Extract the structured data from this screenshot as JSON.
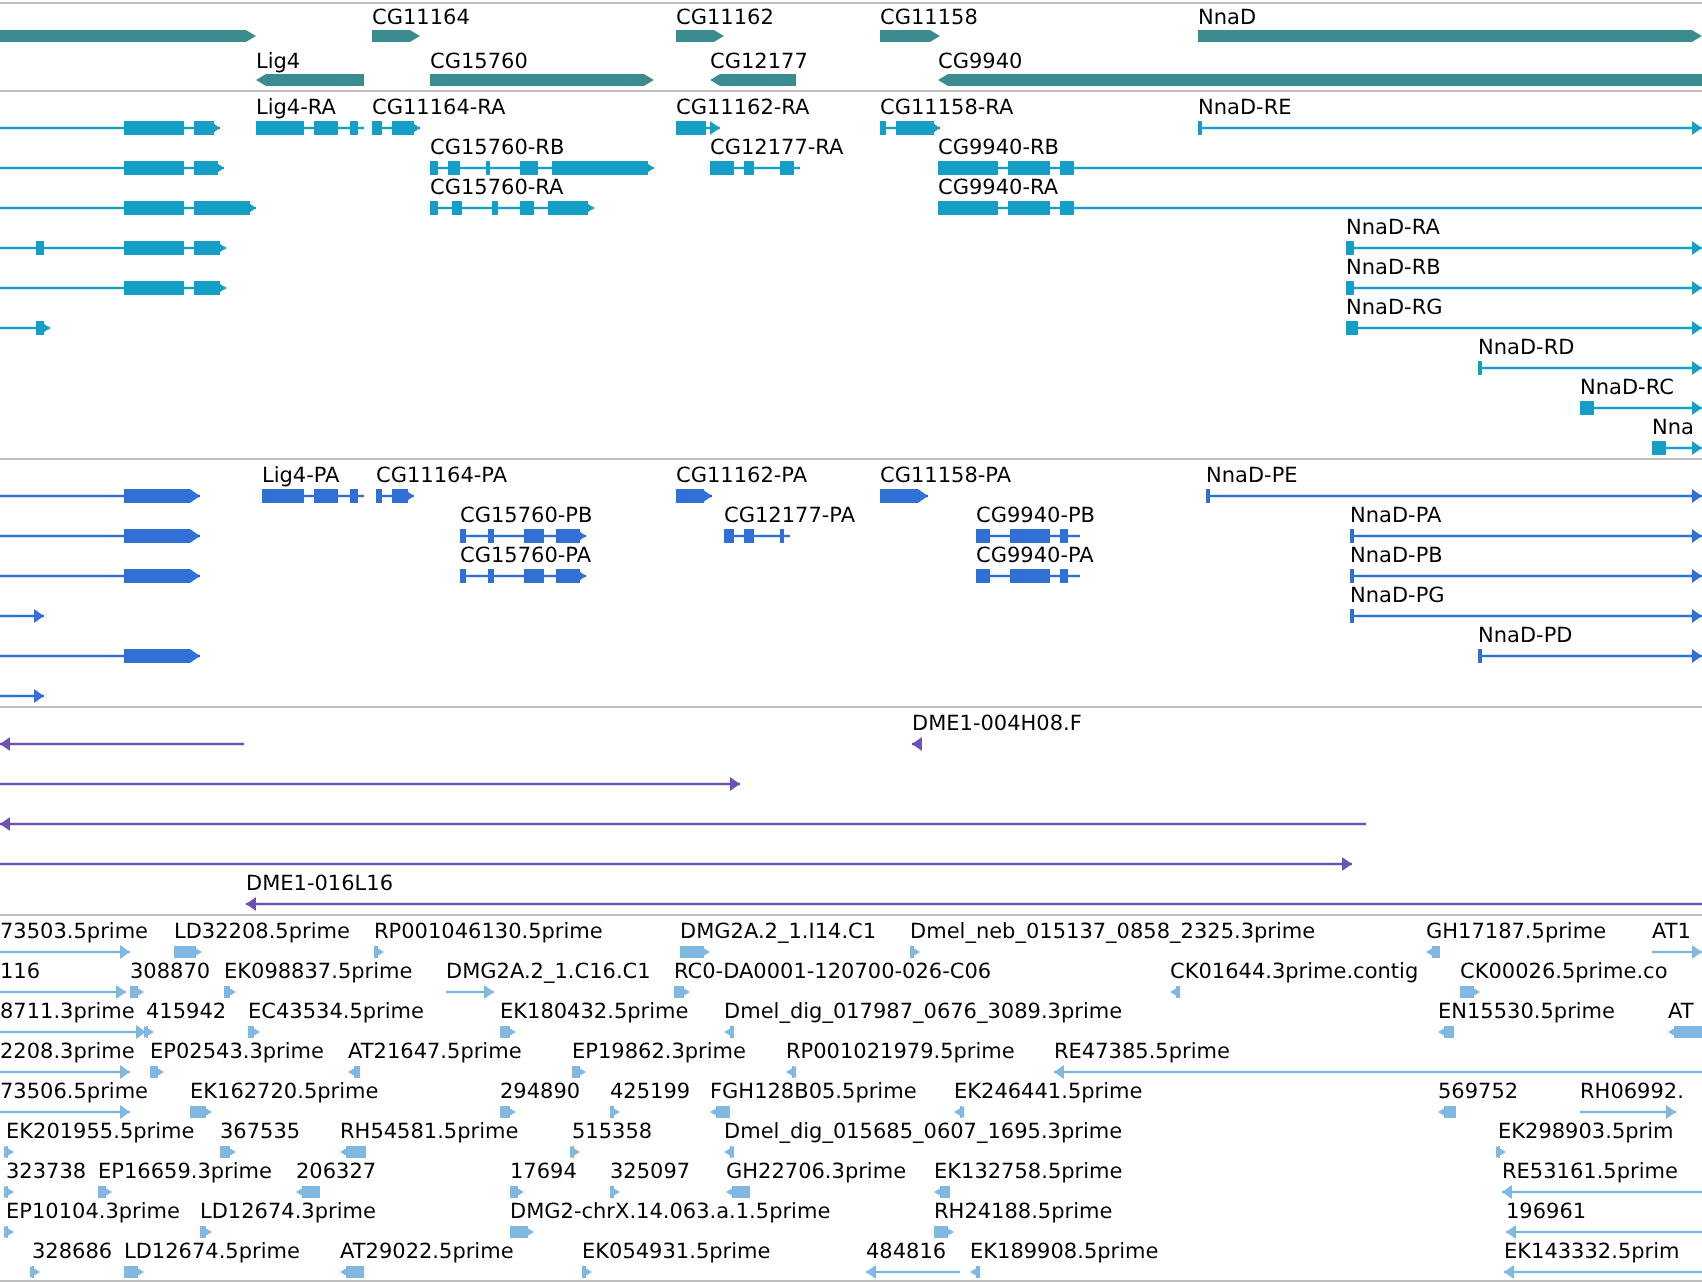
{
  "tracks": [
    {
      "kind": "gene",
      "rows": [
        {
          "features": [
            {
              "forward": true
            },
            {
              "label": "CG11164",
              "forward": true
            },
            {
              "label": "CG11162",
              "forward": true
            },
            {
              "label": "CG11158",
              "forward": true
            },
            {
              "label": "NnaD",
              "forward": true
            }
          ]
        },
        {
          "features": [
            {
              "label": "Lig4",
              "forward": false
            },
            {
              "label": "CG15760",
              "forward": true
            },
            {
              "label": "CG12177",
              "forward": false
            },
            {
              "label": "CG9940",
              "forward": false
            }
          ]
        }
      ]
    },
    {
      "kind": "transcript",
      "rows": [
        {
          "features": [
            {
              "forward": true
            },
            {
              "label": "Lig4-RA",
              "forward": false
            },
            {
              "label": "CG11164-RA",
              "forward": true
            },
            {
              "label": "CG11162-RA",
              "forward": true
            },
            {
              "label": "CG11158-RA",
              "forward": true
            },
            {
              "label": "NnaD-RE",
              "forward": true
            }
          ]
        },
        {
          "features": [
            {
              "forward": true
            },
            {
              "label": "CG15760-RB",
              "forward": true
            },
            {
              "label": "CG12177-RA",
              "forward": false
            },
            {
              "label": "CG9940-RB",
              "forward": false
            }
          ]
        },
        {
          "features": [
            {
              "forward": true
            },
            {
              "label": "CG15760-RA",
              "forward": true
            },
            {
              "label": "CG9940-RA",
              "forward": false
            }
          ]
        },
        {
          "features": [
            {
              "forward": true
            },
            {
              "label": "NnaD-RA",
              "forward": true
            }
          ]
        },
        {
          "features": [
            {
              "forward": true
            },
            {
              "label": "NnaD-RB",
              "forward": true
            }
          ]
        },
        {
          "features": [
            {
              "forward": true
            },
            {
              "label": "NnaD-RG",
              "forward": true
            }
          ]
        },
        {
          "features": [
            {
              "label": "NnaD-RD",
              "forward": true
            }
          ]
        },
        {
          "features": [
            {
              "label": "NnaD-RC",
              "forward": true
            }
          ]
        },
        {
          "features": [
            {
              "label": "Nna",
              "forward": true
            }
          ]
        }
      ]
    },
    {
      "kind": "protein",
      "rows": [
        {
          "features": [
            {
              "forward": true
            },
            {
              "label": "Lig4-PA",
              "forward": false
            },
            {
              "label": "CG11164-PA",
              "forward": true
            },
            {
              "label": "CG11162-PA",
              "forward": true
            },
            {
              "label": "CG11158-PA",
              "forward": true
            },
            {
              "label": "NnaD-PE",
              "forward": true
            }
          ]
        },
        {
          "features": [
            {
              "forward": true
            },
            {
              "label": "CG15760-PB",
              "forward": true
            },
            {
              "label": "CG12177-PA",
              "forward": false
            },
            {
              "label": "CG9940-PB",
              "forward": false
            },
            {
              "label": "NnaD-PA",
              "forward": true
            }
          ]
        },
        {
          "features": [
            {
              "forward": true
            },
            {
              "label": "CG15760-PA",
              "forward": true
            },
            {
              "label": "CG9940-PA",
              "forward": false
            },
            {
              "label": "NnaD-PB",
              "forward": true
            }
          ]
        },
        {
          "features": [
            {
              "forward": true
            },
            {
              "label": "NnaD-PG",
              "forward": true
            }
          ]
        },
        {
          "features": [
            {
              "forward": true
            },
            {
              "label": "NnaD-PD",
              "forward": true
            }
          ]
        },
        {
          "features": [
            {
              "forward": true
            }
          ]
        }
      ]
    },
    {
      "kind": "clone",
      "rows": [
        {
          "features": [
            {
              "forward": false
            },
            {
              "label": "DME1-004H08.F",
              "forward": false
            }
          ]
        },
        {
          "features": [
            {
              "forward": true
            }
          ]
        },
        {
          "features": [
            {
              "forward": false
            }
          ]
        },
        {
          "features": [
            {
              "forward": true
            }
          ]
        },
        {
          "features": [
            {
              "label": "DME1-016L16",
              "forward": false
            }
          ]
        }
      ]
    },
    {
      "kind": "est",
      "rows": [
        {
          "features": [
            {
              "label": "73503.5prime",
              "forward": true
            },
            {
              "label": "LD32208.5prime",
              "forward": true
            },
            {
              "label": "RP001046130.5prime",
              "forward": true
            },
            {
              "label": "DMG2A.2_1.I14.C1",
              "forward": true
            },
            {
              "label": "Dmel_neb_015137_0858_2325.3prime",
              "forward": true
            },
            {
              "label": "GH17187.5prime",
              "forward": false
            },
            {
              "label": "AT1",
              "forward": true
            }
          ]
        },
        {
          "features": [
            {
              "label": "116",
              "forward": true
            },
            {
              "label": "308870",
              "forward": true
            },
            {
              "label": "EK098837.5prime",
              "forward": true
            },
            {
              "label": "DMG2A.2_1.C16.C1",
              "forward": true
            },
            {
              "label": "RC0-DA0001-120700-026-C06",
              "forward": true
            },
            {
              "label": "CK01644.3prime.contig",
              "forward": false
            },
            {
              "label": "CK00026.5prime.co",
              "forward": true
            }
          ]
        },
        {
          "features": [
            {
              "label": "8711.3prime",
              "forward": true
            },
            {
              "label": "415942",
              "forward": true
            },
            {
              "label": "EC43534.5prime",
              "forward": true
            },
            {
              "label": "EK180432.5prime",
              "forward": true
            },
            {
              "label": "Dmel_dig_017987_0676_3089.3prime",
              "forward": false
            },
            {
              "label": "EN15530.5prime",
              "forward": false
            },
            {
              "label": "AT",
              "forward": false
            }
          ]
        },
        {
          "features": [
            {
              "label": "2208.3prime",
              "forward": true
            },
            {
              "label": "EP02543.3prime",
              "forward": true
            },
            {
              "label": "AT21647.5prime",
              "forward": false
            },
            {
              "label": "EP19862.3prime",
              "forward": true
            },
            {
              "label": "RP001021979.5prime",
              "forward": false
            },
            {
              "label": "RE47385.5prime",
              "forward": false
            }
          ]
        },
        {
          "features": [
            {
              "label": "73506.5prime",
              "forward": true
            },
            {
              "label": "EK162720.5prime",
              "forward": true
            },
            {
              "label": "294890",
              "forward": true
            },
            {
              "label": "425199",
              "forward": true
            },
            {
              "label": "FGH128B05.5prime",
              "forward": false
            },
            {
              "label": "EK246441.5prime",
              "forward": false
            },
            {
              "label": "569752",
              "forward": false
            },
            {
              "label": "RH06992.",
              "forward": true
            }
          ]
        },
        {
          "features": [
            {
              "label": "EK201955.5prime",
              "forward": true
            },
            {
              "label": "367535",
              "forward": true
            },
            {
              "label": "RH54581.5prime",
              "forward": false
            },
            {
              "label": "515358",
              "forward": true
            },
            {
              "label": "Dmel_dig_015685_0607_1695.3prime",
              "forward": false
            },
            {
              "label": "EK298903.5prim",
              "forward": true
            }
          ]
        },
        {
          "features": [
            {
              "label": "323738",
              "forward": true
            },
            {
              "label": "EP16659.3prime",
              "forward": true
            },
            {
              "label": "206327",
              "forward": false
            },
            {
              "label": "17694",
              "forward": true
            },
            {
              "label": "325097",
              "forward": true
            },
            {
              "label": "GH22706.3prime",
              "forward": false
            },
            {
              "label": "EK132758.5prime",
              "forward": false
            },
            {
              "label": "RE53161.5prime",
              "forward": false
            }
          ]
        },
        {
          "features": [
            {
              "label": "EP10104.3prime",
              "forward": true
            },
            {
              "label": "LD12674.3prime",
              "forward": true
            },
            {
              "label": "DMG2-chrX.14.063.a.1.5prime",
              "forward": true
            },
            {
              "label": "RH24188.5prime",
              "forward": true
            },
            {
              "label": "196961",
              "forward": false
            }
          ]
        },
        {
          "features": [
            {
              "label": "328686",
              "forward": true
            },
            {
              "label": "LD12674.5prime",
              "forward": true
            },
            {
              "label": "AT29022.5prime",
              "forward": false
            },
            {
              "label": "EK054931.5prime",
              "forward": true
            },
            {
              "label": "484816",
              "forward": false
            },
            {
              "label": "EK189908.5prime",
              "forward": false
            },
            {
              "label": "EK143332.5prim",
              "forward": false
            }
          ]
        }
      ]
    }
  ]
}
